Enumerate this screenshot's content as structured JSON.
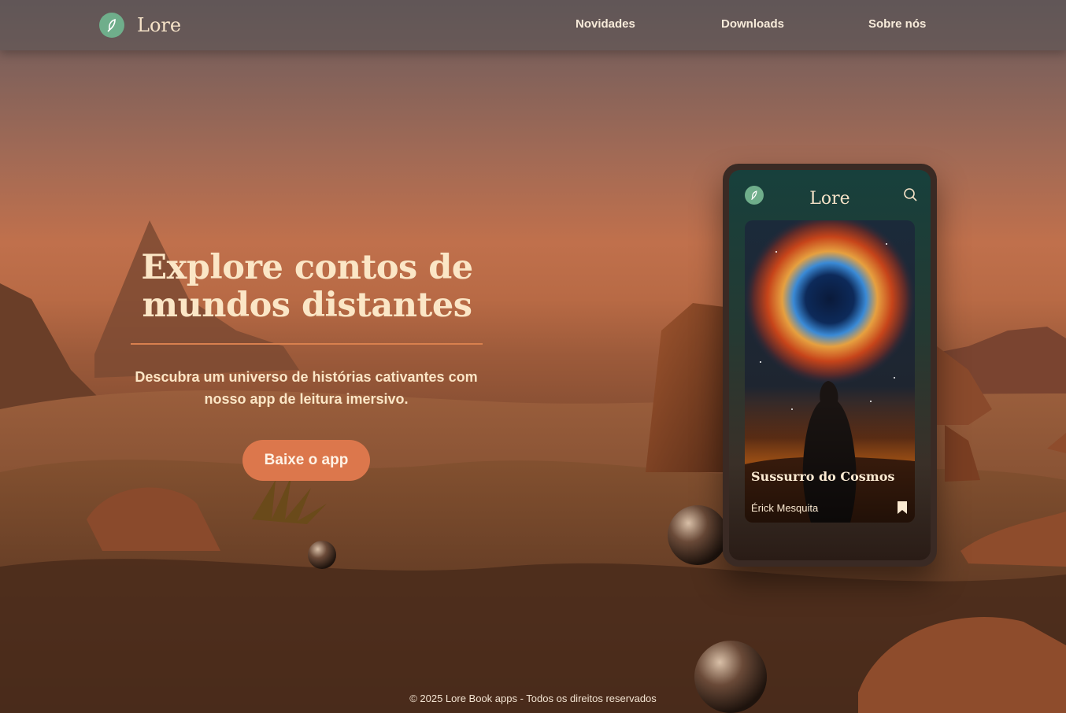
{
  "brand": {
    "name": "Lore",
    "icon": "feather-leaf-icon",
    "accent": "#6fae8b"
  },
  "nav": {
    "items": [
      {
        "label": "Novidades"
      },
      {
        "label": "Downloads"
      },
      {
        "label": "Sobre nós"
      }
    ]
  },
  "hero": {
    "title": "Explore contos de mundos distantes",
    "subtitle": "Descubra um universo de histórias cativantes com nosso app de leitura imersivo.",
    "cta_label": "Baixe o app",
    "cta_color": "#dc774c"
  },
  "phone": {
    "app_title": "Lore",
    "search_icon": "search-icon",
    "book": {
      "title": "Sussurro do Cosmos",
      "author": "Érick Mesquita",
      "bookmark_icon": "bookmark-icon"
    }
  },
  "footer": {
    "text": "© 2025 Lore Book apps - Todos os direitos reservados"
  }
}
